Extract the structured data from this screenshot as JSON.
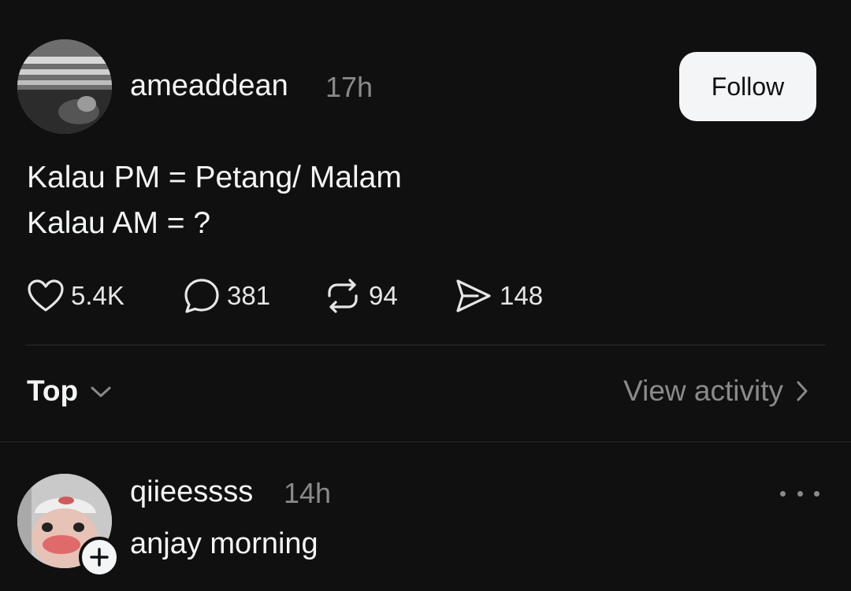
{
  "post": {
    "username": "ameaddean",
    "time": "17h",
    "follow_label": "Follow",
    "lines": [
      "Kalau PM = Petang/ Malam",
      "Kalau AM = ?"
    ],
    "actions": {
      "likes": "5.4K",
      "comments": "381",
      "reposts": "94",
      "shares": "148"
    }
  },
  "thread_controls": {
    "sort_label": "Top",
    "view_activity_label": "View activity"
  },
  "reply": {
    "username": "qiieessss",
    "time": "14h",
    "text": "anjay morning"
  },
  "colors": {
    "background": "#101010",
    "text": "#f3f5f7",
    "muted": "#8a8a8a",
    "follow_button_bg": "#f3f5f7"
  },
  "icons": [
    "heart-icon",
    "comment-icon",
    "repost-icon",
    "share-icon",
    "chevron-down-icon",
    "chevron-right-icon",
    "more-icon",
    "plus-icon"
  ]
}
